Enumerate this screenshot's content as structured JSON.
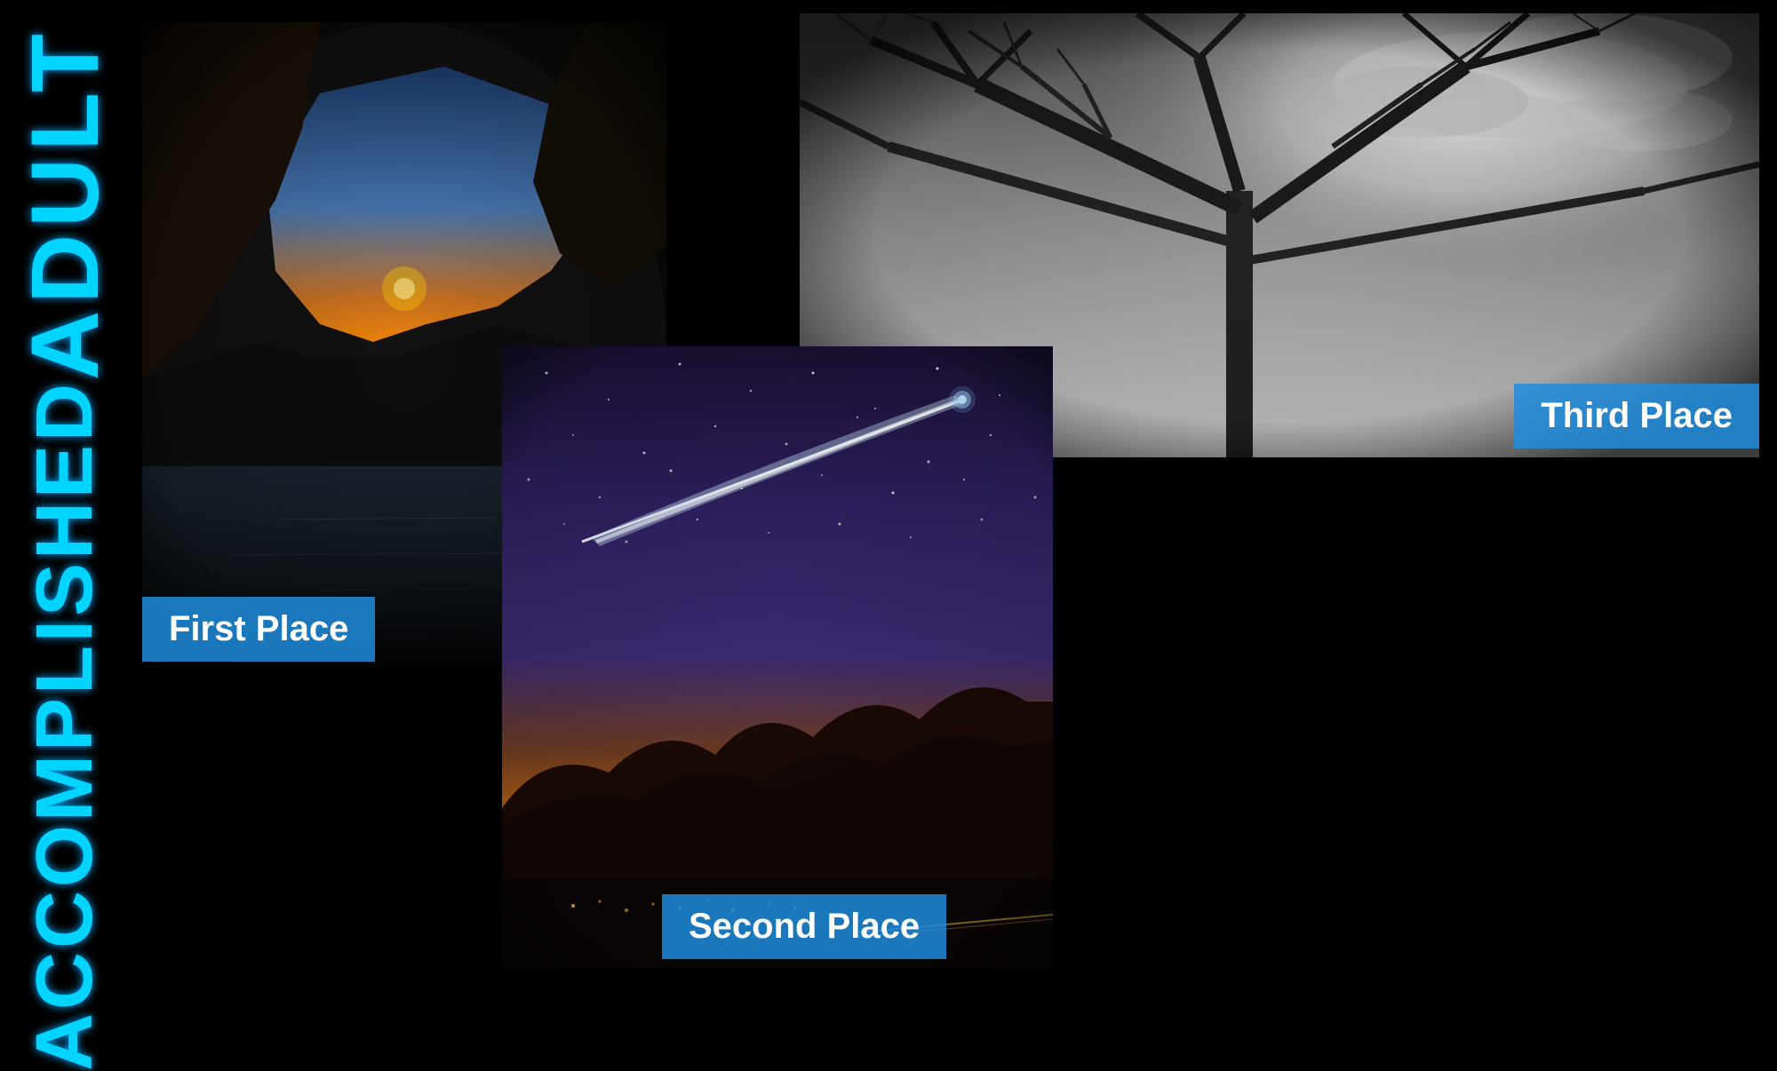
{
  "title": {
    "line1": "ADULT",
    "line2": "ACCOMPLISHED"
  },
  "photos": {
    "first": {
      "label": "First Place",
      "description": "Cave opening with sunset over ocean"
    },
    "second": {
      "label": "Second Place",
      "description": "Comet over mountain landscape at night"
    },
    "third": {
      "label": "Third Place",
      "description": "Bare tree branches against moonlit sky in black and white"
    }
  },
  "colors": {
    "accent": "#00d4ff",
    "label_bg": "rgba(30,140,220,0.85)",
    "background": "#000000"
  }
}
